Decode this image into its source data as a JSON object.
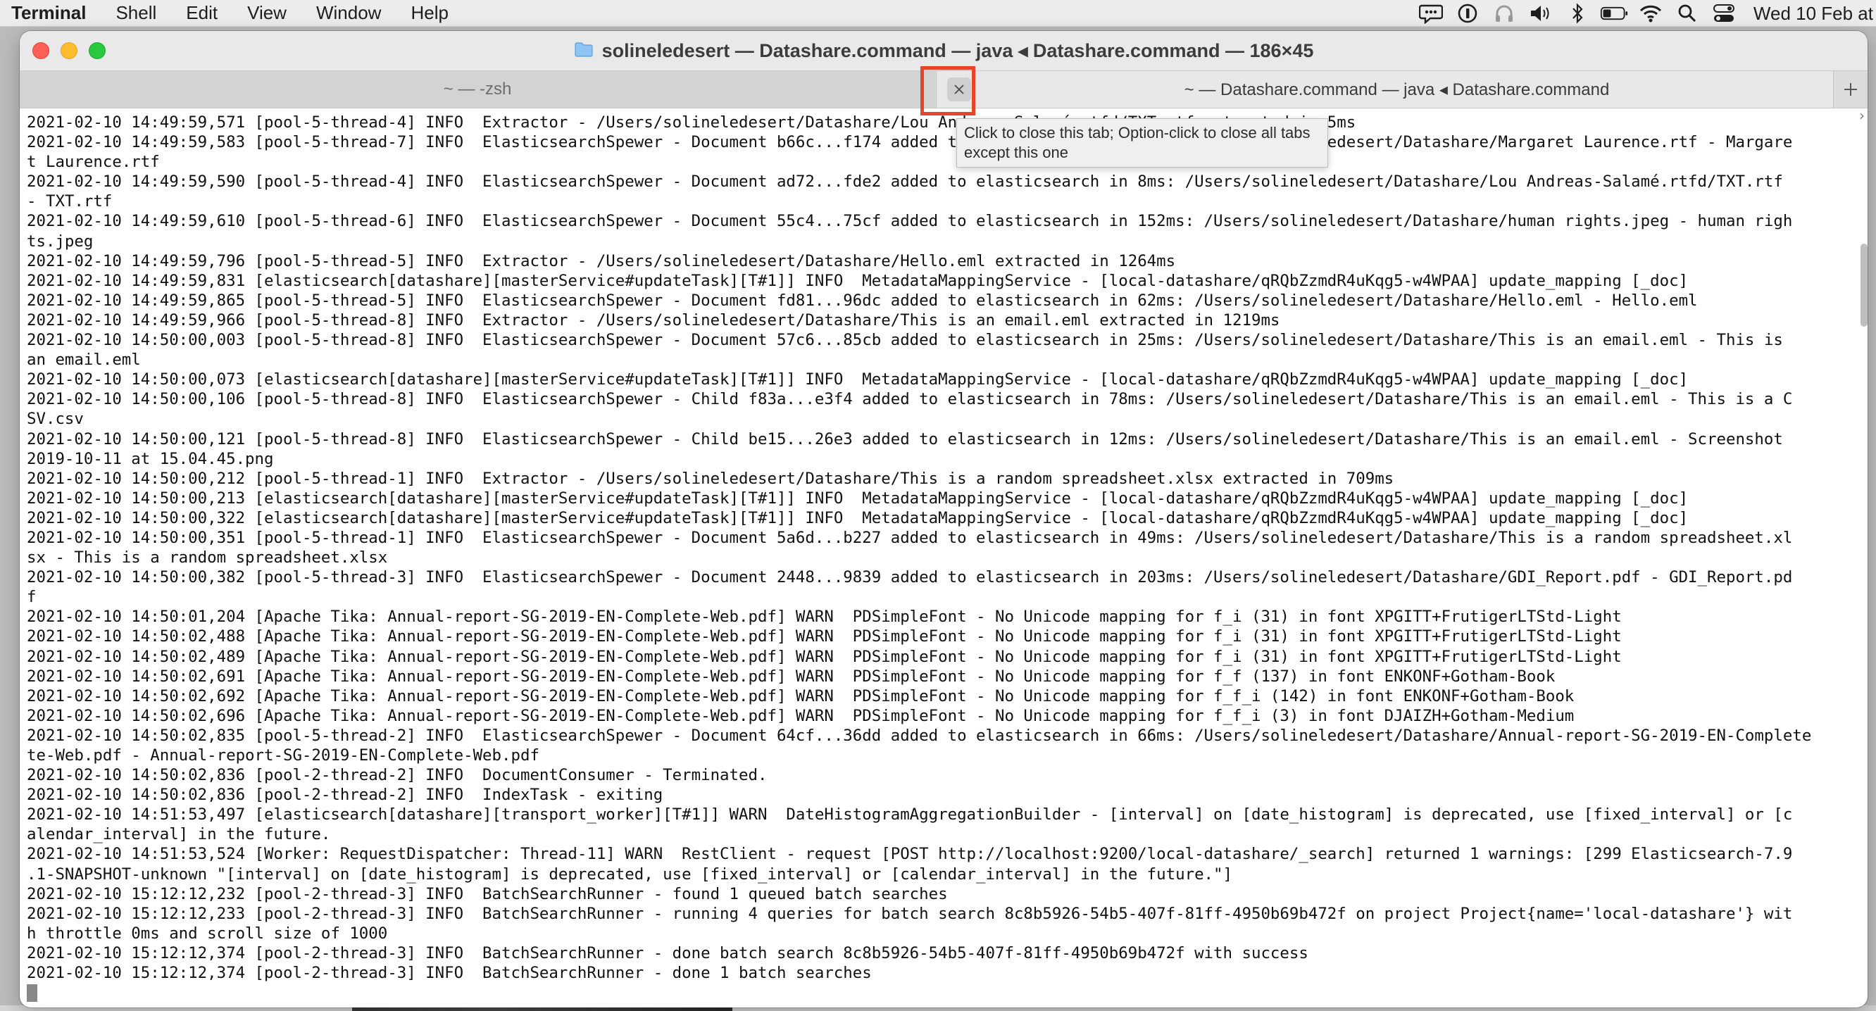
{
  "menubar": {
    "app": "Terminal",
    "items": [
      "Shell",
      "Edit",
      "View",
      "Window",
      "Help"
    ],
    "status_icons": [
      "chat-icon",
      "one-password-icon",
      "headphones-icon",
      "volume-icon",
      "bluetooth-icon",
      "battery-icon",
      "wifi-icon",
      "search-icon",
      "control-center-icon"
    ],
    "clock": "Wed 10 Feb at"
  },
  "window": {
    "title": "solineledesert — Datashare.command — java ◂ Datashare.command — 186×45",
    "tabs": [
      {
        "label": "~ — -zsh"
      },
      {
        "label": "~ — Datashare.command — java ◂ Datashare.command"
      }
    ],
    "tooltip": "Click to close this tab; Option-click to close all tabs except this one",
    "accent_highlight": "#e8442c"
  },
  "terminal": {
    "lines": [
      "2021-02-10 14:49:59,571 [pool-5-thread-4] INFO  Extractor - /Users/solineledesert/Datashare/Lou Andreas-Salamé.rtfd/TXT.rtf extracted in 5ms",
      "2021-02-10 14:49:59,583 [pool-5-thread-7] INFO  ElasticsearchSpewer - Document b66c...f174 added to elasticsearch in 15ms: /Users/solineledesert/Datashare/Margaret Laurence.rtf - Margare",
      "t Laurence.rtf",
      "2021-02-10 14:49:59,590 [pool-5-thread-4] INFO  ElasticsearchSpewer - Document ad72...fde2 added to elasticsearch in 8ms: /Users/solineledesert/Datashare/Lou Andreas-Salamé.rtfd/TXT.rtf",
      "- TXT.rtf",
      "2021-02-10 14:49:59,610 [pool-5-thread-6] INFO  ElasticsearchSpewer - Document 55c4...75cf added to elasticsearch in 152ms: /Users/solineledesert/Datashare/human rights.jpeg - human righ",
      "ts.jpeg",
      "2021-02-10 14:49:59,796 [pool-5-thread-5] INFO  Extractor - /Users/solineledesert/Datashare/Hello.eml extracted in 1264ms",
      "2021-02-10 14:49:59,831 [elasticsearch[datashare][masterService#updateTask][T#1]] INFO  MetadataMappingService - [local-datashare/qRQbZzmdR4uKqg5-w4WPAA] update_mapping [_doc]",
      "2021-02-10 14:49:59,865 [pool-5-thread-5] INFO  ElasticsearchSpewer - Document fd81...96dc added to elasticsearch in 62ms: /Users/solineledesert/Datashare/Hello.eml - Hello.eml",
      "2021-02-10 14:49:59,966 [pool-5-thread-8] INFO  Extractor - /Users/solineledesert/Datashare/This is an email.eml extracted in 1219ms",
      "2021-02-10 14:50:00,003 [pool-5-thread-8] INFO  ElasticsearchSpewer - Document 57c6...85cb added to elasticsearch in 25ms: /Users/solineledesert/Datashare/This is an email.eml - This is",
      "an email.eml",
      "2021-02-10 14:50:00,073 [elasticsearch[datashare][masterService#updateTask][T#1]] INFO  MetadataMappingService - [local-datashare/qRQbZzmdR4uKqg5-w4WPAA] update_mapping [_doc]",
      "2021-02-10 14:50:00,106 [pool-5-thread-8] INFO  ElasticsearchSpewer - Child f83a...e3f4 added to elasticsearch in 78ms: /Users/solineledesert/Datashare/This is an email.eml - This is a C",
      "SV.csv",
      "2021-02-10 14:50:00,121 [pool-5-thread-8] INFO  ElasticsearchSpewer - Child be15...26e3 added to elasticsearch in 12ms: /Users/solineledesert/Datashare/This is an email.eml - Screenshot",
      "2019-10-11 at 15.04.45.png",
      "2021-02-10 14:50:00,212 [pool-5-thread-1] INFO  Extractor - /Users/solineledesert/Datashare/This is a random spreadsheet.xlsx extracted in 709ms",
      "2021-02-10 14:50:00,213 [elasticsearch[datashare][masterService#updateTask][T#1]] INFO  MetadataMappingService - [local-datashare/qRQbZzmdR4uKqg5-w4WPAA] update_mapping [_doc]",
      "2021-02-10 14:50:00,322 [elasticsearch[datashare][masterService#updateTask][T#1]] INFO  MetadataMappingService - [local-datashare/qRQbZzmdR4uKqg5-w4WPAA] update_mapping [_doc]",
      "2021-02-10 14:50:00,351 [pool-5-thread-1] INFO  ElasticsearchSpewer - Document 5a6d...b227 added to elasticsearch in 49ms: /Users/solineledesert/Datashare/This is a random spreadsheet.xl",
      "sx - This is a random spreadsheet.xlsx",
      "2021-02-10 14:50:00,382 [pool-5-thread-3] INFO  ElasticsearchSpewer - Document 2448...9839 added to elasticsearch in 203ms: /Users/solineledesert/Datashare/GDI_Report.pdf - GDI_Report.pd",
      "f",
      "2021-02-10 14:50:01,204 [Apache Tika: Annual-report-SG-2019-EN-Complete-Web.pdf] WARN  PDSimpleFont - No Unicode mapping for f_i (31) in font XPGITT+FrutigerLTStd-Light",
      "2021-02-10 14:50:02,488 [Apache Tika: Annual-report-SG-2019-EN-Complete-Web.pdf] WARN  PDSimpleFont - No Unicode mapping for f_i (31) in font XPGITT+FrutigerLTStd-Light",
      "2021-02-10 14:50:02,489 [Apache Tika: Annual-report-SG-2019-EN-Complete-Web.pdf] WARN  PDSimpleFont - No Unicode mapping for f_i (31) in font XPGITT+FrutigerLTStd-Light",
      "2021-02-10 14:50:02,691 [Apache Tika: Annual-report-SG-2019-EN-Complete-Web.pdf] WARN  PDSimpleFont - No Unicode mapping for f_f (137) in font ENKONF+Gotham-Book",
      "2021-02-10 14:50:02,692 [Apache Tika: Annual-report-SG-2019-EN-Complete-Web.pdf] WARN  PDSimpleFont - No Unicode mapping for f_f_i (142) in font ENKONF+Gotham-Book",
      "2021-02-10 14:50:02,696 [Apache Tika: Annual-report-SG-2019-EN-Complete-Web.pdf] WARN  PDSimpleFont - No Unicode mapping for f_f_i (3) in font DJAIZH+Gotham-Medium",
      "2021-02-10 14:50:02,835 [pool-5-thread-2] INFO  ElasticsearchSpewer - Document 64cf...36dd added to elasticsearch in 66ms: /Users/solineledesert/Datashare/Annual-report-SG-2019-EN-Complete",
      "te-Web.pdf - Annual-report-SG-2019-EN-Complete-Web.pdf",
      "2021-02-10 14:50:02,836 [pool-2-thread-2] INFO  DocumentConsumer - Terminated.",
      "2021-02-10 14:50:02,836 [pool-2-thread-2] INFO  IndexTask - exiting",
      "2021-02-10 14:51:53,497 [elasticsearch[datashare][transport_worker][T#1]] WARN  DateHistogramAggregationBuilder - [interval] on [date_histogram] is deprecated, use [fixed_interval] or [c",
      "alendar_interval] in the future.",
      "2021-02-10 14:51:53,524 [Worker: RequestDispatcher: Thread-11] WARN  RestClient - request [POST http://localhost:9200/local-datashare/_search] returned 1 warnings: [299 Elasticsearch-7.9",
      ".1-SNAPSHOT-unknown \"[interval] on [date_histogram] is deprecated, use [fixed_interval] or [calendar_interval] in the future.\"]",
      "2021-02-10 15:12:12,232 [pool-2-thread-3] INFO  BatchSearchRunner - found 1 queued batch searches",
      "2021-02-10 15:12:12,233 [pool-2-thread-3] INFO  BatchSearchRunner - running 4 queries for batch search 8c8b5926-54b5-407f-81ff-4950b69b472f on project Project{name='local-datashare'} wit",
      "h throttle 0ms and scroll size of 1000",
      "2021-02-10 15:12:12,374 [pool-2-thread-3] INFO  BatchSearchRunner - done batch search 8c8b5926-54b5-407f-81ff-4950b69b472f with success",
      "2021-02-10 15:12:12,374 [pool-2-thread-3] INFO  BatchSearchRunner - done 1 batch searches"
    ]
  }
}
